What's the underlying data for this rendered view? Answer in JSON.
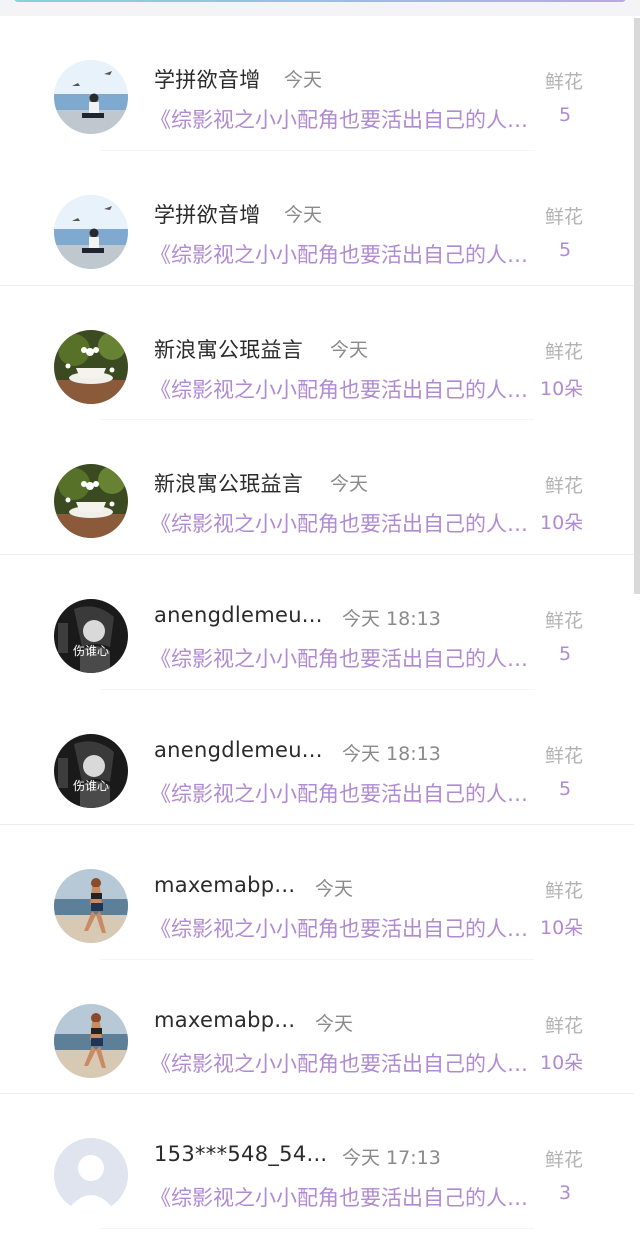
{
  "list": {
    "items": [
      {
        "name": "学拼欲音增",
        "time": "今天",
        "title": "《综影视之小小配角也要活出自己的人生》",
        "label": "鲜花",
        "amount": "5",
        "avatar": "man-sea-avatar"
      },
      {
        "name": "学拼欲音增",
        "time": "今天",
        "title": "《综影视之小小配角也要活出自己的人生》",
        "label": "鲜花",
        "amount": "5",
        "avatar": "man-sea-avatar"
      },
      {
        "name": "新浪寓公珉益言",
        "time": "今天",
        "title": "《综影视之小小配角也要活出自己的人生》",
        "label": "鲜花",
        "amount": "10朵",
        "avatar": "teacup-flower-avatar"
      },
      {
        "name": "新浪寓公珉益言",
        "time": "今天",
        "title": "《综影视之小小配角也要活出自己的人生》",
        "label": "鲜花",
        "amount": "10朵",
        "avatar": "teacup-flower-avatar"
      },
      {
        "name": "anengdlemeu...",
        "time": "今天 18:13",
        "title": "《综影视之小小配角也要活出自己的人生》",
        "label": "鲜花",
        "amount": "5",
        "avatar": "dark-portrait-avatar",
        "avatar_text": "伤谁心"
      },
      {
        "name": "anengdlemeu...",
        "time": "今天 18:13",
        "title": "《综影视之小小配角也要活出自己的人生》",
        "label": "鲜花",
        "amount": "5",
        "avatar": "dark-portrait-avatar",
        "avatar_text": "伤谁心"
      },
      {
        "name": "maxemabp...",
        "time": "今天",
        "title": "《综影视之小小配角也要活出自己的人生》",
        "label": "鲜花",
        "amount": "10朵",
        "avatar": "beach-runner-avatar"
      },
      {
        "name": "maxemabp...",
        "time": "今天",
        "title": "《综影视之小小配角也要活出自己的人生》",
        "label": "鲜花",
        "amount": "10朵",
        "avatar": "beach-runner-avatar"
      },
      {
        "name": "153***548_54...",
        "time": "今天 17:13",
        "title": "《综影视之小小配角也要活出自己的人生》",
        "label": "鲜花",
        "amount": "3",
        "avatar": "default-user-avatar"
      }
    ]
  },
  "colors": {
    "title_purple": "#b08ad3",
    "name_text": "#2b2b2b",
    "meta_gray": "#8a8a8a"
  }
}
